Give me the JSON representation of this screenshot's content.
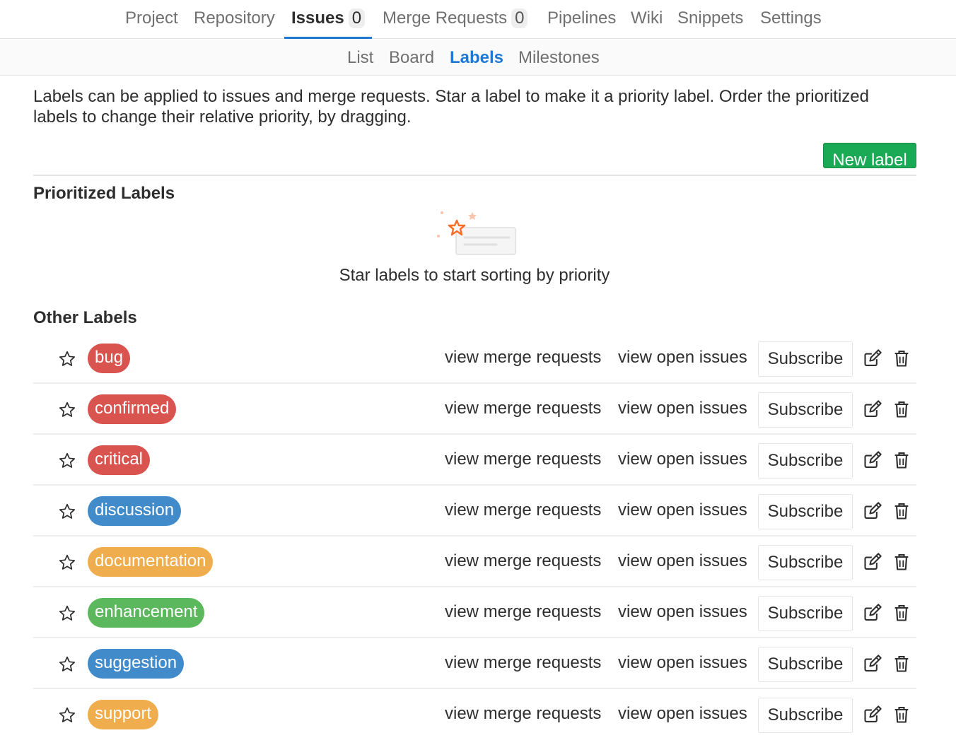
{
  "nav": {
    "tabs": [
      {
        "label": "Project"
      },
      {
        "label": "Repository"
      },
      {
        "label": "Issues",
        "count": "0"
      },
      {
        "label": "Merge Requests",
        "count": "0"
      },
      {
        "label": "Pipelines"
      },
      {
        "label": "Wiki"
      },
      {
        "label": "Snippets"
      },
      {
        "label": "Settings"
      }
    ],
    "active_tab": "Issues"
  },
  "subnav": {
    "tabs": [
      {
        "label": "List"
      },
      {
        "label": "Board"
      },
      {
        "label": "Labels"
      },
      {
        "label": "Milestones"
      }
    ],
    "active_tab": "Labels"
  },
  "intro": "Labels can be applied to issues and merge requests. Star a label to make it a priority label. Order the prioritized labels to change their relative priority, by dragging.",
  "new_label_button": "New label",
  "prioritized": {
    "title": "Prioritized Labels",
    "empty_text": "Star labels to start sorting by priority"
  },
  "other": {
    "title": "Other Labels",
    "labels": [
      {
        "name": "bug",
        "color": "#d9534f"
      },
      {
        "name": "confirmed",
        "color": "#d9534f"
      },
      {
        "name": "critical",
        "color": "#d9534f"
      },
      {
        "name": "discussion",
        "color": "#428bca"
      },
      {
        "name": "documentation",
        "color": "#f0ad4e"
      },
      {
        "name": "enhancement",
        "color": "#5cb85c"
      },
      {
        "name": "suggestion",
        "color": "#428bca"
      },
      {
        "name": "support",
        "color": "#f0ad4e"
      }
    ]
  },
  "row_actions": {
    "merge_requests_link": "view merge requests",
    "open_issues_link": "view open issues",
    "subscribe_button": "Subscribe",
    "star_icon": "star-outline-icon",
    "edit_icon": "edit-icon",
    "delete_icon": "trash-icon"
  },
  "colors": {
    "accent": "#1f78d1",
    "new_button": "#1aaa55",
    "empty_illustration_star": "#fc6d26"
  }
}
